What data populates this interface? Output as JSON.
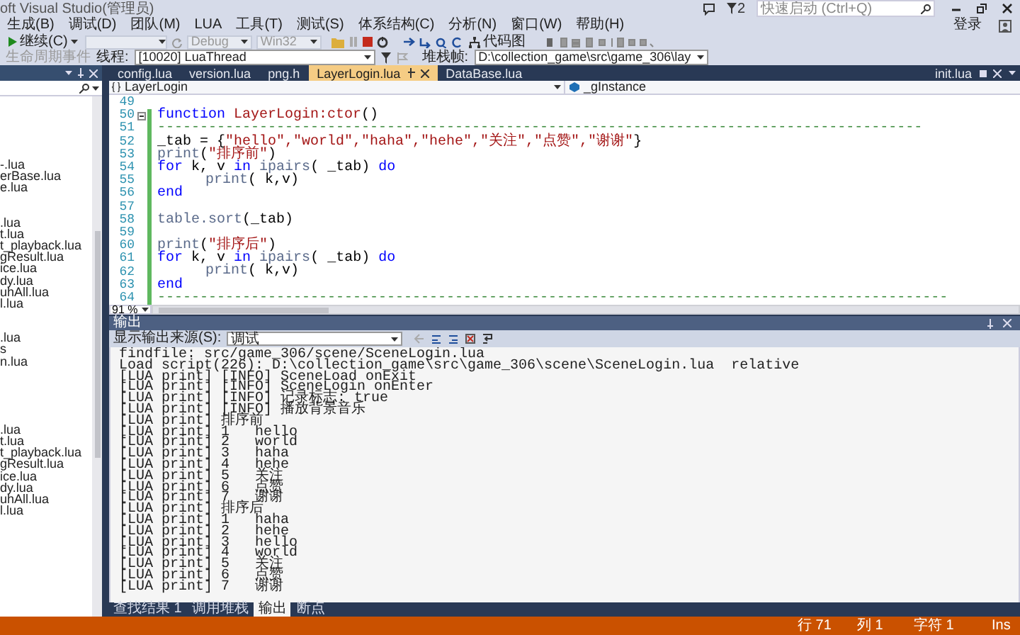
{
  "window": {
    "title": "oft Visual Studio(管理员)",
    "notification_count": "2",
    "quick_launch": {
      "placeholder": "快速启动 (Ctrl+Q)"
    },
    "sign_in": "登录"
  },
  "menu": [
    "生成(B)",
    "调试(D)",
    "团队(M)",
    "LUA",
    "工具(T)",
    "测试(S)",
    "体系结构(C)",
    "分析(N)",
    "窗口(W)",
    "帮助(H)"
  ],
  "toolbar": {
    "continue": "继续(C)",
    "combos": [
      {
        "value": "Debug",
        "disabled": true
      },
      {
        "value": "Win32",
        "disabled": true
      }
    ],
    "code_map": "代码图"
  },
  "debug_location": {
    "lifecycle": {
      "label": "生命周期事件",
      "disabled": true
    },
    "thread_label": "线程:",
    "thread": "[10020] LuaThread",
    "stack_label": "堆栈帧:",
    "stack_frame": "D:\\collection_game\\src\\game_306\\lay"
  },
  "document_tabs": [
    {
      "label": "config.lua",
      "selected": false
    },
    {
      "label": "version.lua",
      "selected": false
    },
    {
      "label": "png.h",
      "selected": false
    },
    {
      "label": "LayerLogin.lua",
      "selected": true
    },
    {
      "label": "DataBase.lua",
      "selected": false
    }
  ],
  "overflow_tab": "init.lua",
  "solution_explorer": {
    "groups": [
      [
        "-.lua",
        "erBase.lua",
        "e.lua"
      ],
      [
        ".lua",
        "t.lua",
        "t_playback.lua",
        "gResult.lua",
        "ice.lua",
        "dy.lua",
        "uhAll.lua",
        "l.lua"
      ],
      [
        ".lua",
        "s",
        "n.lua"
      ],
      [
        ".lua",
        "t.lua",
        "t_playback.lua",
        "gResult.lua",
        "ice.lua",
        "dy.lua",
        "uhAll.lua",
        "l.lua"
      ]
    ]
  },
  "editor": {
    "type_scope": "LayerLogin",
    "member_scope": "_gInstance",
    "zoom": "91 %",
    "lines": [
      {
        "number": "49",
        "fold": false,
        "modified": false
      },
      {
        "number": "50",
        "fold": true,
        "modified": true,
        "tokens": [
          {
            "kind": "keyword",
            "text": "function "
          },
          {
            "kind": "name",
            "text": "LayerLogin:ctor"
          },
          {
            "kind": "plain",
            "text": "()"
          }
        ]
      },
      {
        "number": "51",
        "fold": false,
        "modified": true,
        "tokens": [
          {
            "kind": "comment",
            "text": "------------------------------------------------------------------------------------------"
          }
        ]
      },
      {
        "number": "52",
        "fold": false,
        "modified": true,
        "tokens": [
          {
            "kind": "plain",
            "text": "_tab = {"
          },
          {
            "kind": "string",
            "text": "\"hello\",\"world\",\"haha\",\"hehe\",\"关注\",\"点赞\",\"谢谢\""
          },
          {
            "kind": "plain",
            "text": "}"
          }
        ]
      },
      {
        "number": "53",
        "fold": false,
        "modified": true,
        "tokens": [
          {
            "kind": "builtin",
            "text": "print"
          },
          {
            "kind": "plain",
            "text": "("
          },
          {
            "kind": "string",
            "text": "\"排序前\""
          },
          {
            "kind": "plain",
            "text": ")"
          }
        ]
      },
      {
        "number": "54",
        "fold": false,
        "modified": true,
        "tokens": [
          {
            "kind": "keyword",
            "text": "for"
          },
          {
            "kind": "plain",
            "text": " k, v "
          },
          {
            "kind": "keyword",
            "text": "in"
          },
          {
            "kind": "builtin",
            "text": " ipairs"
          },
          {
            "kind": "plain",
            "text": "( _tab) "
          },
          {
            "kind": "keyword",
            "text": "do"
          }
        ],
        "children": [
          {
            "number": "55",
            "fold": false,
            "modified": true,
            "tokens": [
              {
                "kind": "builtin",
                "text": "print"
              },
              {
                "kind": "plain",
                "text": "( k,v)"
              }
            ]
          }
        ]
      },
      {
        "number": "56",
        "fold": false,
        "modified": true,
        "tokens": [
          {
            "kind": "keyword",
            "text": "end"
          }
        ]
      },
      {
        "number": "57",
        "fold": false,
        "modified": true
      },
      {
        "number": "58",
        "fold": false,
        "modified": true,
        "tokens": [
          {
            "kind": "builtin",
            "text": "table.sort"
          },
          {
            "kind": "plain",
            "text": "(_tab)"
          }
        ]
      },
      {
        "number": "59",
        "fold": false,
        "modified": true
      },
      {
        "number": "60",
        "fold": false,
        "modified": true,
        "tokens": [
          {
            "kind": "builtin",
            "text": "print"
          },
          {
            "kind": "plain",
            "text": "("
          },
          {
            "kind": "string",
            "text": "\"排序后\""
          },
          {
            "kind": "plain",
            "text": ")"
          }
        ]
      },
      {
        "number": "61",
        "fold": false,
        "modified": true,
        "tokens": [
          {
            "kind": "keyword",
            "text": "for"
          },
          {
            "kind": "plain",
            "text": " k, v "
          },
          {
            "kind": "keyword",
            "text": "in"
          },
          {
            "kind": "builtin",
            "text": " ipairs"
          },
          {
            "kind": "plain",
            "text": "( _tab) "
          },
          {
            "kind": "keyword",
            "text": "do"
          }
        ],
        "children": [
          {
            "number": "62",
            "fold": false,
            "modified": true,
            "tokens": [
              {
                "kind": "builtin",
                "text": "print"
              },
              {
                "kind": "plain",
                "text": "( k,v)"
              }
            ]
          }
        ]
      },
      {
        "number": "63",
        "fold": false,
        "modified": true,
        "tokens": [
          {
            "kind": "keyword",
            "text": "end"
          }
        ]
      },
      {
        "number": "64",
        "fold": false,
        "modified": true,
        "tokens": [
          {
            "kind": "comment",
            "text": "---------------------------------------------------------------------------------------------"
          }
        ]
      }
    ]
  },
  "output": {
    "title": "输出",
    "source_label": "显示输出来源(S):",
    "source": "调试",
    "lines": [
      "findfile: src/game_306/scene/SceneLogin.lua",
      "Load script(226): D:\\collection_game\\src\\game_306\\scene\\SceneLogin.lua  relative",
      "[LUA print] [INFO] SceneLoad onExit",
      "[LUA print] [INFO] SceneLogin onEnter",
      "[LUA print] [INFO] 记录标志: true",
      "[LUA print] [INFO] 播放背景音乐",
      "[LUA print] 排序前",
      "[LUA print] 1   hello",
      "[LUA print] 2   world",
      "[LUA print] 3   haha",
      "[LUA print] 4   hehe",
      "[LUA print] 5   关注",
      "[LUA print] 6   点赞",
      "[LUA print] 7   谢谢",
      "[LUA print] 排序后",
      "[LUA print] 1   haha",
      "[LUA print] 2   hehe",
      "[LUA print] 3   hello",
      "[LUA print] 4   world",
      "[LUA print] 5   关注",
      "[LUA print] 6   点赞",
      "[LUA print] 7   谢谢"
    ]
  },
  "bottom_tabs": [
    {
      "label": "查找结果 1",
      "selected": false
    },
    {
      "label": "调用堆栈",
      "selected": false
    },
    {
      "label": "输出",
      "selected": true
    },
    {
      "label": "断点",
      "selected": false
    }
  ],
  "status_bar": {
    "line": "行 71",
    "column": "列 1",
    "character": "字符 1",
    "mode": "Ins"
  }
}
